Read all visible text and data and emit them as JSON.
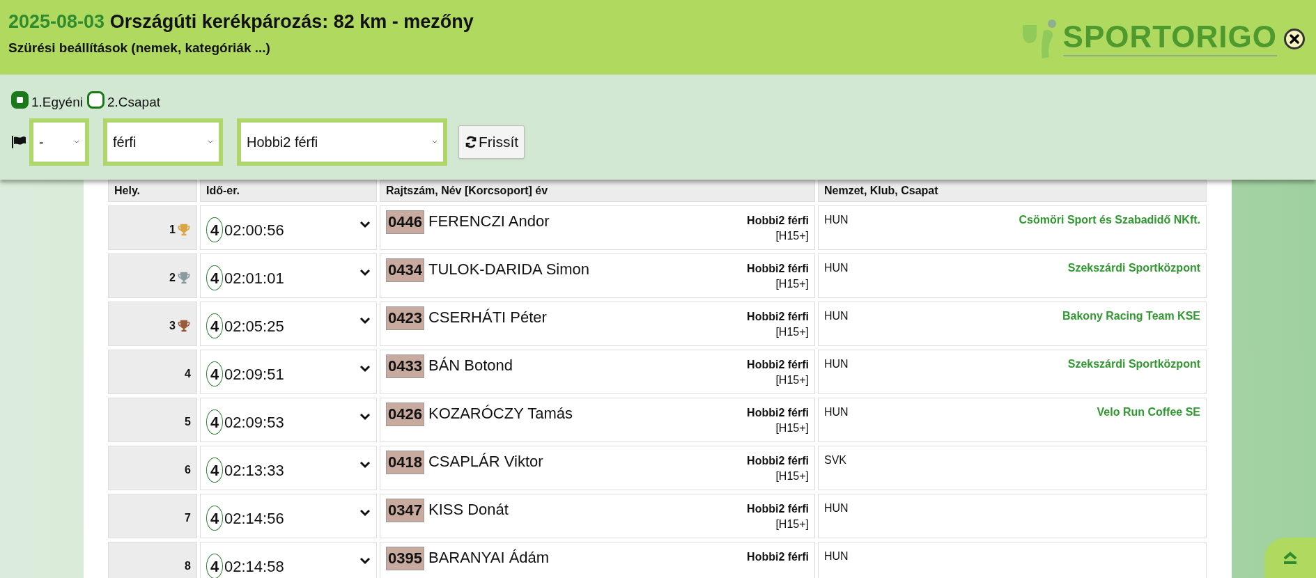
{
  "header": {
    "date": "2025-08-03",
    "title": "Országúti kerékpározás: 82 km - mezőny",
    "subtitle": "Szürési beállítások (nemek, kategóriák ...)",
    "logo": "SPORTORIGO"
  },
  "filters": {
    "modes": [
      {
        "label": "1.Egyéni",
        "selected": true
      },
      {
        "label": "2.Csapat",
        "selected": false
      }
    ],
    "selects": [
      {
        "value": "-"
      },
      {
        "value": "férfi"
      },
      {
        "value": "Hobbi2 férfi"
      }
    ],
    "refresh_button": "Frissít"
  },
  "table": {
    "columns": [
      "Hely.",
      "Idő-er.",
      "Rajtszám, Név [Korcsoport] év",
      "Nemzet, Klub, Csapat"
    ],
    "rows": [
      {
        "place": "1",
        "color": "#d9a441",
        "laps": "4",
        "time": "02:00:56",
        "bib": "0446",
        "name": "FERENCZI Andor",
        "category": "Hobbi2 férfi",
        "age_group": "[H15+]",
        "nation": "HUN",
        "club": "Csömöri Sport és Szabadidő NKft."
      },
      {
        "place": "2",
        "color": "#8a9a9e",
        "laps": "4",
        "time": "02:01:01",
        "bib": "0434",
        "name": "TULOK-DARIDA Simon",
        "category": "Hobbi2 férfi",
        "age_group": "[H15+]",
        "nation": "HUN",
        "club": "Szekszárdi Sportközpont"
      },
      {
        "place": "3",
        "color": "#9a5a3c",
        "laps": "4",
        "time": "02:05:25",
        "bib": "0423",
        "name": "CSERHÁTI Péter",
        "category": "Hobbi2 férfi",
        "age_group": "[H15+]",
        "nation": "HUN",
        "club": "Bakony Racing Team KSE"
      },
      {
        "place": "4",
        "laps": "4",
        "time": "02:09:51",
        "bib": "0433",
        "name": "BÁN Botond",
        "category": "Hobbi2 férfi",
        "age_group": "[H15+]",
        "nation": "HUN",
        "club": "Szekszárdi Sportközpont"
      },
      {
        "place": "5",
        "laps": "4",
        "time": "02:09:53",
        "bib": "0426",
        "name": "KOZARÓCZY Tamás",
        "category": "Hobbi2 férfi",
        "age_group": "[H15+]",
        "nation": "HUN",
        "club": "Velo Run Coffee SE"
      },
      {
        "place": "6",
        "laps": "4",
        "time": "02:13:33",
        "bib": "0418",
        "name": "CSAPLÁR Viktor",
        "category": "Hobbi2 férfi",
        "age_group": "[H15+]",
        "nation": "SVK"
      },
      {
        "place": "7",
        "laps": "4",
        "time": "02:14:56",
        "bib": "0347",
        "name": "KISS Donát",
        "category": "Hobbi2 férfi",
        "age_group": "[H15+]",
        "nation": "HUN"
      },
      {
        "place": "8",
        "laps": "4",
        "time": "02:14:58",
        "bib": "0395",
        "name": "BARANYAI Ádám",
        "category": "Hobbi2 férfi",
        "nation": "HUN"
      }
    ]
  }
}
